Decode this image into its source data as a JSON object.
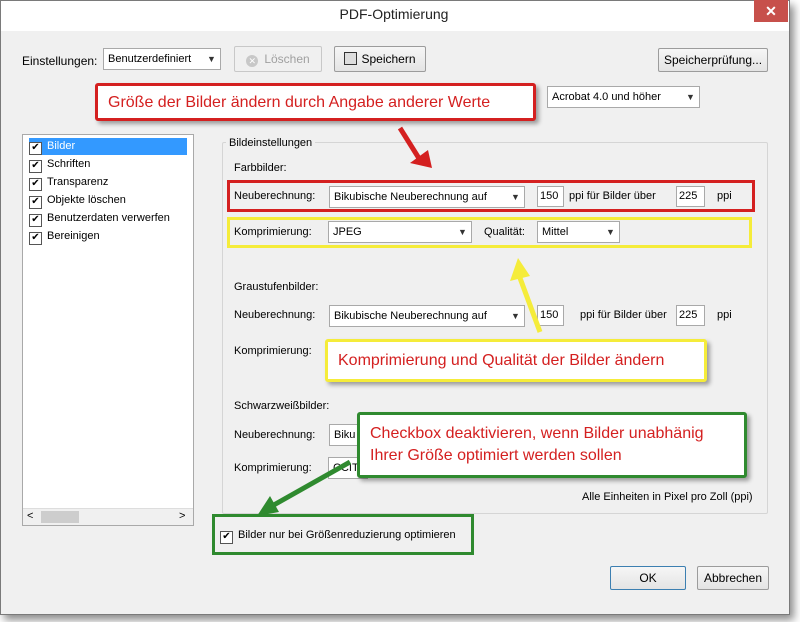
{
  "window": {
    "title": "PDF-Optimierung",
    "close_glyph": "✕"
  },
  "top": {
    "settings_label": "Einstellungen:",
    "settings_value": "Benutzerdefiniert",
    "delete_label": "Löschen",
    "save_label": "Speichern",
    "check_label": "Speicherprüfung...",
    "compat_value": "Acrobat 4.0 und höher"
  },
  "sidebar": {
    "items": [
      {
        "label": "Bilder",
        "checked": true,
        "selected": true
      },
      {
        "label": "Schriften",
        "checked": true
      },
      {
        "label": "Transparenz",
        "checked": true
      },
      {
        "label": "Objekte löschen",
        "checked": true
      },
      {
        "label": "Benutzerdaten verwerfen",
        "checked": true
      },
      {
        "label": "Bereinigen",
        "checked": true
      }
    ],
    "scroll_left": "<",
    "scroll_right": ">"
  },
  "image_settings": {
    "group_title": "Bildeinstellungen",
    "color": {
      "title": "Farbbilder:",
      "resample_label": "Neuberechnung:",
      "resample_value": "Bikubische Neuberechnung auf",
      "ppi_value": "150",
      "above_label": "ppi für Bilder über",
      "above_value": "225",
      "ppi_unit": "ppi",
      "compression_label": "Komprimierung:",
      "compression_value": "JPEG",
      "quality_label": "Qualität:",
      "quality_value": "Mittel"
    },
    "gray": {
      "title": "Graustufenbilder:",
      "resample_label": "Neuberechnung:",
      "resample_value": "Bikubische Neuberechnung auf",
      "ppi_value": "150",
      "above_label": "ppi für Bilder über",
      "above_value": "225",
      "ppi_unit": "ppi",
      "compression_label": "Komprimierung:"
    },
    "bw": {
      "title": "Schwarzweißbilder:",
      "resample_label": "Neuberechnung:",
      "resample_value": "Biku",
      "compression_label": "Komprimierung:",
      "compression_value": "CCIT"
    },
    "units_note": "Alle Einheiten in Pixel pro Zoll (ppi)",
    "optimize_checkbox": "Bilder nur bei Größenreduzierung optimieren"
  },
  "buttons": {
    "ok": "OK",
    "cancel": "Abbrechen"
  },
  "annotations": {
    "red": "Größe der Bilder ändern durch Angabe anderer Werte",
    "yellow": "Komprimierung und Qualität der Bilder ändern",
    "green_line1": "Checkbox deaktivieren, wenn Bilder unabhänig",
    "green_line2": "Ihrer Größe optimiert werden sollen"
  },
  "colors": {
    "red": "#d42020",
    "yellow": "#f5ec3a",
    "green": "#2f8a2f",
    "selection": "#3399ff"
  },
  "checkmark": "✔",
  "dropdown_arrow": "▼"
}
